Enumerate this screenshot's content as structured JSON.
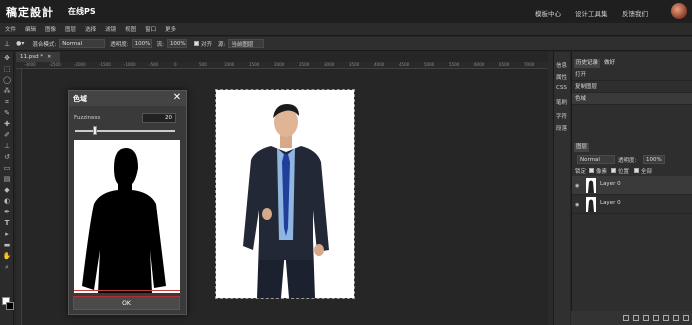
{
  "header": {
    "logo": "稿定設計",
    "subtitle": "在线PS",
    "links": [
      "模板中心",
      "设计工具集",
      "反馈我们"
    ]
  },
  "menu": [
    "文件",
    "编辑",
    "图像",
    "图层",
    "选择",
    "滤镜",
    "视图",
    "窗口",
    "更多"
  ],
  "options": {
    "mode_label": "混合模式:",
    "mode_value": "Normal",
    "opacity_label": "透明度:",
    "opacity_value": "100%",
    "flow_label": "流:",
    "flow_value": "100%",
    "align_label": "对齐",
    "source_label": "源:",
    "source_value": "当前图层"
  },
  "document": {
    "tab": "11.psd *"
  },
  "ruler": {
    "ticks": [
      "-3000",
      "-2500",
      "-2000",
      "-1500",
      "-1000",
      "-500",
      "0",
      "500",
      "1000",
      "1500",
      "2000",
      "2500",
      "3000",
      "3500",
      "4000",
      "4500",
      "5000",
      "5500",
      "6000",
      "6500",
      "7000"
    ]
  },
  "dialog": {
    "title": "色域",
    "close": "✕",
    "fuzziness_label": "Fuzziness",
    "fuzziness_value": "20",
    "fuzziness_fraction": 0.2,
    "ok_label": "OK"
  },
  "right_icons": [
    "信息",
    "属性",
    "CSS",
    "笔刷",
    "字符",
    "段落"
  ],
  "history": {
    "tabs": [
      "历史记录",
      "做好"
    ],
    "items": [
      "打开",
      "复制图层",
      "色域"
    ]
  },
  "layers": {
    "tab": "图层",
    "mode_value": "Normal",
    "opacity_label": "透明度:",
    "opacity_value": "100%",
    "lock_label": "锁定",
    "lock_options": [
      "像素",
      "位置",
      "全部"
    ],
    "items": [
      {
        "name": "Layer 0"
      },
      {
        "name": "Layer 0"
      }
    ]
  },
  "colors": {
    "accent_red": "#b23030",
    "panel_bg": "#2e2e2e"
  }
}
